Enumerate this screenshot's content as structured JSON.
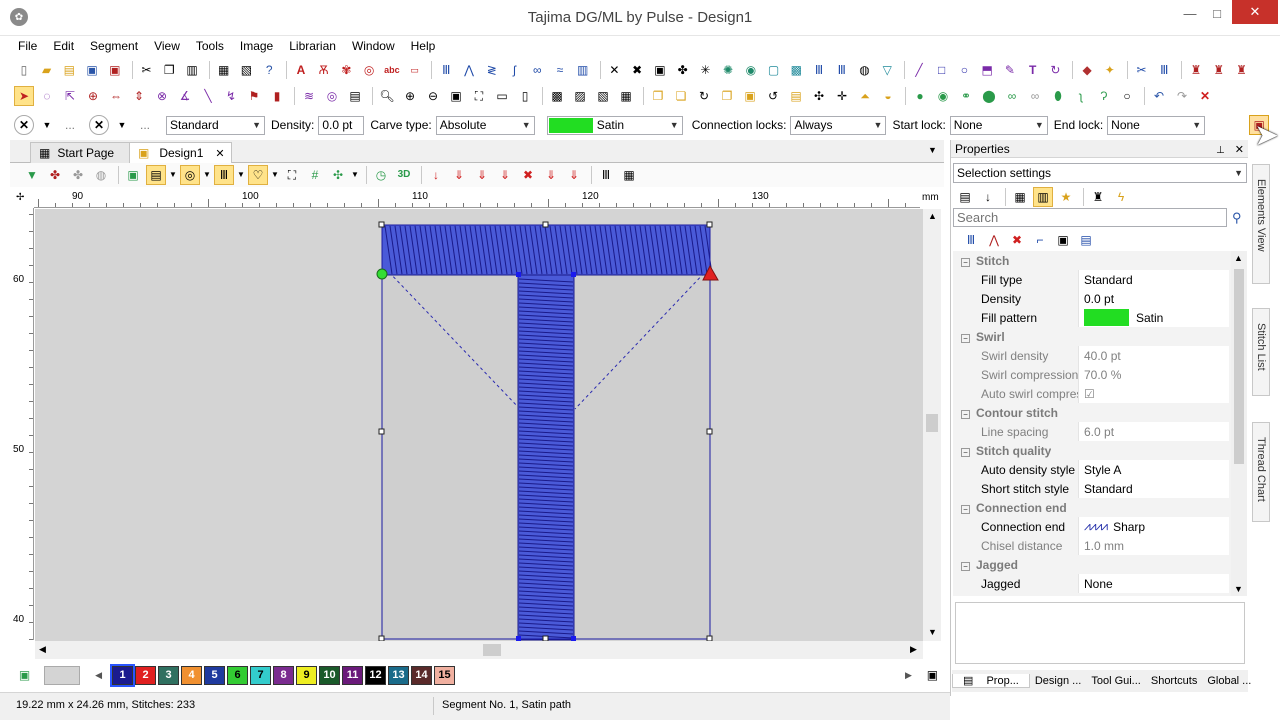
{
  "window": {
    "title": "Tajima DG/ML by Pulse - Design1",
    "minimize": "—",
    "maximize": "□",
    "close": "✕"
  },
  "menu": [
    "File",
    "Edit",
    "Segment",
    "View",
    "Tools",
    "Image",
    "Librarian",
    "Window",
    "Help"
  ],
  "toolbar3": {
    "style_value": "Standard",
    "density_label": "Density:",
    "density_value": "0.0 pt",
    "carve_label": "Carve type:",
    "carve_value": "Absolute",
    "fill_value": "Satin",
    "fill_color": "#22dd22",
    "connlocks_label": "Connection locks:",
    "connlocks_value": "Always",
    "startlock_label": "Start lock:",
    "startlock_value": "None",
    "endlock_label": "End lock:",
    "endlock_value": "None",
    "ellipsis": "..."
  },
  "tabs": {
    "start_page": "Start Page",
    "design1": "Design1",
    "close": "✕"
  },
  "ruler": {
    "unit": "mm",
    "h_ticks": [
      "90",
      "100",
      "110",
      "120",
      "130"
    ],
    "v_ticks": [
      "60",
      "50",
      "40"
    ]
  },
  "colors": [
    {
      "n": "1",
      "c": "#1b1b8f"
    },
    {
      "n": "2",
      "c": "#e02020"
    },
    {
      "n": "3",
      "c": "#2f7060"
    },
    {
      "n": "4",
      "c": "#f09030"
    },
    {
      "n": "5",
      "c": "#1f3a9e"
    },
    {
      "n": "6",
      "c": "#33cc33"
    },
    {
      "n": "7",
      "c": "#33cccc"
    },
    {
      "n": "8",
      "c": "#7a2b8f"
    },
    {
      "n": "9",
      "c": "#eeee22"
    },
    {
      "n": "10",
      "c": "#1a5a2a"
    },
    {
      "n": "11",
      "c": "#6a1a7a"
    },
    {
      "n": "12",
      "c": "#000000"
    },
    {
      "n": "13",
      "c": "#1a6b8a"
    },
    {
      "n": "14",
      "c": "#5a2a2a"
    },
    {
      "n": "15",
      "c": "#f0b0a0"
    }
  ],
  "status": {
    "dims": "19.22 mm x 24.26 mm, Stitches: 233",
    "segment": "Segment No. 1, Satin path"
  },
  "properties": {
    "title": "Properties",
    "pin": "⊥",
    "close": "✕",
    "selector": "Selection settings",
    "search_placeholder": "Search",
    "rows": [
      {
        "type": "cat",
        "label": "Stitch"
      },
      {
        "type": "prop",
        "label": "Fill type",
        "value": "Standard"
      },
      {
        "type": "prop",
        "label": "Density",
        "value": "0.0 pt"
      },
      {
        "type": "fill",
        "label": "Fill pattern",
        "value": "Satin"
      },
      {
        "type": "cat",
        "label": "Swirl"
      },
      {
        "type": "dim",
        "label": "Swirl density",
        "value": "40.0 pt"
      },
      {
        "type": "dim",
        "label": "Swirl compression",
        "value": "70.0 %"
      },
      {
        "type": "dim",
        "label": "Auto swirl compress...",
        "value": "☑"
      },
      {
        "type": "cat",
        "label": "Contour stitch"
      },
      {
        "type": "dim",
        "label": "Line spacing",
        "value": "6.0 pt"
      },
      {
        "type": "cat",
        "label": "Stitch quality"
      },
      {
        "type": "prop",
        "label": "Auto density style",
        "value": "Style A"
      },
      {
        "type": "prop",
        "label": "Short stitch style",
        "value": "Standard"
      },
      {
        "type": "cat",
        "label": "Connection end"
      },
      {
        "type": "conn",
        "label": "Connection end",
        "value": "Sharp"
      },
      {
        "type": "dim",
        "label": "Chisel distance",
        "value": "1.0 mm"
      },
      {
        "type": "cat",
        "label": "Jagged"
      },
      {
        "type": "prop",
        "label": "Jagged",
        "value": "None"
      }
    ]
  },
  "side_tabs": [
    "Elements View",
    "Stitch List",
    "Thread Chart"
  ],
  "bottom_tabs": [
    "Prop...",
    "Design ...",
    "Tool Gui...",
    "Shortcuts",
    "Global ..."
  ]
}
